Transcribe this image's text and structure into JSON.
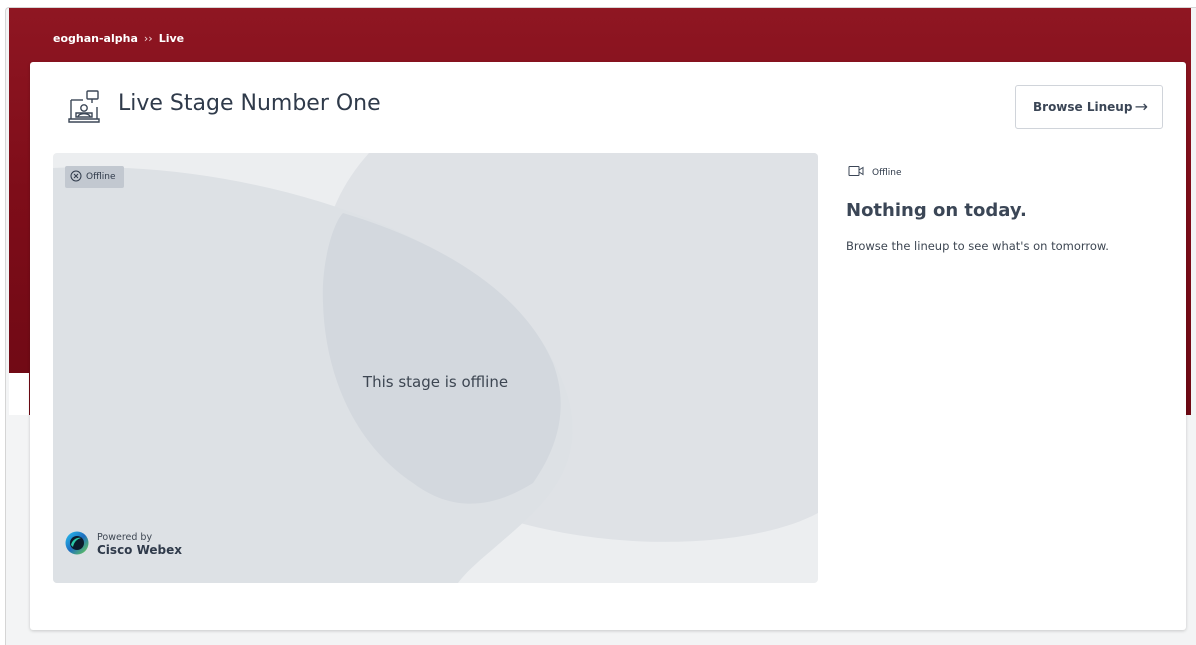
{
  "breadcrumb": {
    "root": "eoghan-alpha",
    "separator": "››",
    "current": "Live"
  },
  "stage": {
    "title": "Live Stage Number One",
    "icon": "stage-presenter-icon"
  },
  "browse_button": {
    "label": "Browse Lineup",
    "arrow": "→"
  },
  "video": {
    "status_badge": "Offline",
    "message": "This stage is offline",
    "powered_by": "Powered by",
    "provider": "Cisco Webex"
  },
  "sidebar": {
    "status": "Offline",
    "heading": "Nothing on today.",
    "subtext": "Browse the lineup to see what's on tomorrow."
  },
  "colors": {
    "banner": "#7e0d19",
    "card": "#ffffff",
    "video_bg": "#eceef0",
    "badge_bg": "#c2c8d0",
    "text_dark": "#2f3a4a"
  }
}
